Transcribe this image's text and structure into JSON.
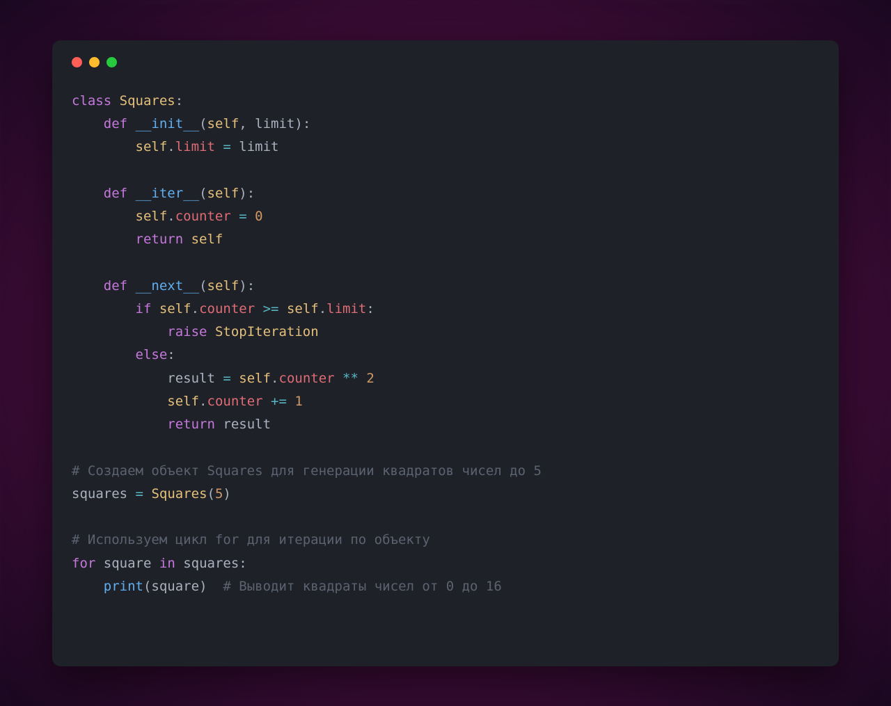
{
  "window": {
    "traffic_lights": [
      "red",
      "yellow",
      "green"
    ]
  },
  "code": {
    "tokens": [
      {
        "type": "keyword",
        "text": "class"
      },
      {
        "type": "white",
        "text": " "
      },
      {
        "type": "classname",
        "text": "Squares"
      },
      {
        "type": "punctuation",
        "text": ":"
      },
      {
        "type": "newline"
      },
      {
        "type": "white",
        "text": "    "
      },
      {
        "type": "keyword",
        "text": "def"
      },
      {
        "type": "white",
        "text": " "
      },
      {
        "type": "function",
        "text": "__init__"
      },
      {
        "type": "punctuation",
        "text": "("
      },
      {
        "type": "self",
        "text": "self"
      },
      {
        "type": "punctuation",
        "text": ", "
      },
      {
        "type": "param",
        "text": "limit"
      },
      {
        "type": "punctuation",
        "text": "):"
      },
      {
        "type": "newline"
      },
      {
        "type": "white",
        "text": "        "
      },
      {
        "type": "self",
        "text": "self"
      },
      {
        "type": "punctuation",
        "text": "."
      },
      {
        "type": "property",
        "text": "limit"
      },
      {
        "type": "white",
        "text": " "
      },
      {
        "type": "operator",
        "text": "="
      },
      {
        "type": "white",
        "text": " "
      },
      {
        "type": "param",
        "text": "limit"
      },
      {
        "type": "newline"
      },
      {
        "type": "newline"
      },
      {
        "type": "white",
        "text": "    "
      },
      {
        "type": "keyword",
        "text": "def"
      },
      {
        "type": "white",
        "text": " "
      },
      {
        "type": "function",
        "text": "__iter__"
      },
      {
        "type": "punctuation",
        "text": "("
      },
      {
        "type": "self",
        "text": "self"
      },
      {
        "type": "punctuation",
        "text": "):"
      },
      {
        "type": "newline"
      },
      {
        "type": "white",
        "text": "        "
      },
      {
        "type": "self",
        "text": "self"
      },
      {
        "type": "punctuation",
        "text": "."
      },
      {
        "type": "property",
        "text": "counter"
      },
      {
        "type": "white",
        "text": " "
      },
      {
        "type": "operator",
        "text": "="
      },
      {
        "type": "white",
        "text": " "
      },
      {
        "type": "number",
        "text": "0"
      },
      {
        "type": "newline"
      },
      {
        "type": "white",
        "text": "        "
      },
      {
        "type": "keyword",
        "text": "return"
      },
      {
        "type": "white",
        "text": " "
      },
      {
        "type": "self",
        "text": "self"
      },
      {
        "type": "newline"
      },
      {
        "type": "newline"
      },
      {
        "type": "white",
        "text": "    "
      },
      {
        "type": "keyword",
        "text": "def"
      },
      {
        "type": "white",
        "text": " "
      },
      {
        "type": "function",
        "text": "__next__"
      },
      {
        "type": "punctuation",
        "text": "("
      },
      {
        "type": "self",
        "text": "self"
      },
      {
        "type": "punctuation",
        "text": "):"
      },
      {
        "type": "newline"
      },
      {
        "type": "white",
        "text": "        "
      },
      {
        "type": "keyword",
        "text": "if"
      },
      {
        "type": "white",
        "text": " "
      },
      {
        "type": "self",
        "text": "self"
      },
      {
        "type": "punctuation",
        "text": "."
      },
      {
        "type": "property",
        "text": "counter"
      },
      {
        "type": "white",
        "text": " "
      },
      {
        "type": "operator",
        "text": ">="
      },
      {
        "type": "white",
        "text": " "
      },
      {
        "type": "self",
        "text": "self"
      },
      {
        "type": "punctuation",
        "text": "."
      },
      {
        "type": "property",
        "text": "limit"
      },
      {
        "type": "punctuation",
        "text": ":"
      },
      {
        "type": "newline"
      },
      {
        "type": "white",
        "text": "            "
      },
      {
        "type": "keyword",
        "text": "raise"
      },
      {
        "type": "white",
        "text": " "
      },
      {
        "type": "exception",
        "text": "StopIteration"
      },
      {
        "type": "newline"
      },
      {
        "type": "white",
        "text": "        "
      },
      {
        "type": "keyword",
        "text": "else"
      },
      {
        "type": "punctuation",
        "text": ":"
      },
      {
        "type": "newline"
      },
      {
        "type": "white",
        "text": "            "
      },
      {
        "type": "param",
        "text": "result"
      },
      {
        "type": "white",
        "text": " "
      },
      {
        "type": "operator",
        "text": "="
      },
      {
        "type": "white",
        "text": " "
      },
      {
        "type": "self",
        "text": "self"
      },
      {
        "type": "punctuation",
        "text": "."
      },
      {
        "type": "property",
        "text": "counter"
      },
      {
        "type": "white",
        "text": " "
      },
      {
        "type": "operator",
        "text": "**"
      },
      {
        "type": "white",
        "text": " "
      },
      {
        "type": "number",
        "text": "2"
      },
      {
        "type": "newline"
      },
      {
        "type": "white",
        "text": "            "
      },
      {
        "type": "self",
        "text": "self"
      },
      {
        "type": "punctuation",
        "text": "."
      },
      {
        "type": "property",
        "text": "counter"
      },
      {
        "type": "white",
        "text": " "
      },
      {
        "type": "operator",
        "text": "+="
      },
      {
        "type": "white",
        "text": " "
      },
      {
        "type": "number",
        "text": "1"
      },
      {
        "type": "newline"
      },
      {
        "type": "white",
        "text": "            "
      },
      {
        "type": "keyword",
        "text": "return"
      },
      {
        "type": "white",
        "text": " "
      },
      {
        "type": "param",
        "text": "result"
      },
      {
        "type": "newline"
      },
      {
        "type": "newline"
      },
      {
        "type": "comment",
        "text": "# Создаем объект Squares для генерации квадратов чисел до 5"
      },
      {
        "type": "newline"
      },
      {
        "type": "param",
        "text": "squares"
      },
      {
        "type": "white",
        "text": " "
      },
      {
        "type": "operator",
        "text": "="
      },
      {
        "type": "white",
        "text": " "
      },
      {
        "type": "classname",
        "text": "Squares"
      },
      {
        "type": "punctuation",
        "text": "("
      },
      {
        "type": "number",
        "text": "5"
      },
      {
        "type": "punctuation",
        "text": ")"
      },
      {
        "type": "newline"
      },
      {
        "type": "newline"
      },
      {
        "type": "comment",
        "text": "# Используем цикл for для итерации по объекту"
      },
      {
        "type": "newline"
      },
      {
        "type": "keyword",
        "text": "for"
      },
      {
        "type": "white",
        "text": " "
      },
      {
        "type": "param",
        "text": "square"
      },
      {
        "type": "white",
        "text": " "
      },
      {
        "type": "keyword",
        "text": "in"
      },
      {
        "type": "white",
        "text": " "
      },
      {
        "type": "param",
        "text": "squares"
      },
      {
        "type": "punctuation",
        "text": ":"
      },
      {
        "type": "newline"
      },
      {
        "type": "white",
        "text": "    "
      },
      {
        "type": "builtin",
        "text": "print"
      },
      {
        "type": "punctuation",
        "text": "("
      },
      {
        "type": "param",
        "text": "square"
      },
      {
        "type": "punctuation",
        "text": ")"
      },
      {
        "type": "white",
        "text": "  "
      },
      {
        "type": "comment",
        "text": "# Выводит квадраты чисел от 0 до 16"
      }
    ]
  }
}
